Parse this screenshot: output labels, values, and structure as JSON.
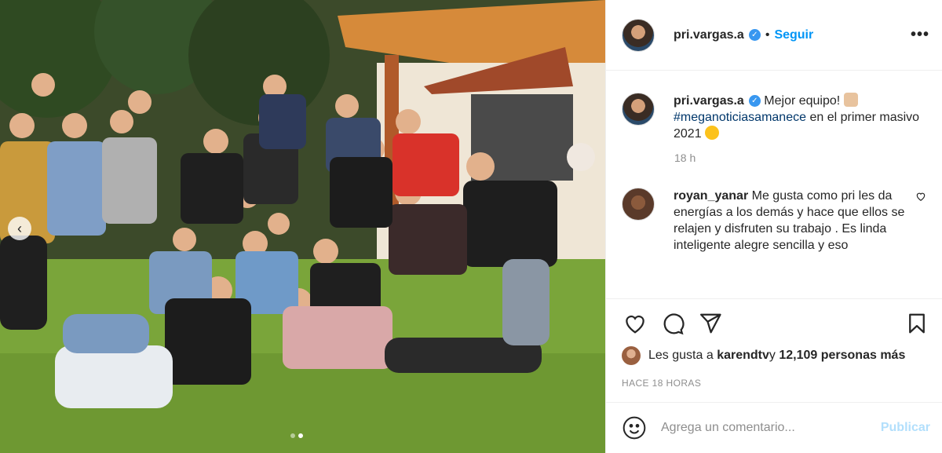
{
  "post": {
    "username": "pri.vargas.a",
    "separator": "•",
    "follow_label": "Seguir",
    "more_label": "•••",
    "photo_alt": "Group photo"
  },
  "caption": {
    "username": "pri.vargas.a",
    "text_before": "Mejor equipo! ",
    "hashtag": "#meganoticiasamanece",
    "text_after": " en el primer masivo 2021 ",
    "time": "18 h"
  },
  "comment": {
    "username": "royan_yanar",
    "text": " Me gusta como pri les da energías a los demás y hace que ellos se relajen y disfruten su trabajo . Es linda inteligente alegre sencilla y eso"
  },
  "likes": {
    "prefix": "Les gusta a ",
    "user": "karendtv",
    "middle": " y ",
    "count": "12,109 personas más"
  },
  "timestamp": "HACE 18 HORAS",
  "add_comment": {
    "placeholder": "Agrega un comentario...",
    "publish_label": "Publicar"
  },
  "icons": {
    "verified": "verified-badge-icon",
    "like": "heart-icon",
    "comment": "comment-bubble-icon",
    "share": "paper-plane-icon",
    "save": "bookmark-icon",
    "emoji": "smiley-face-icon",
    "prev": "chevron-left-icon"
  },
  "colors": {
    "link": "#0095f6",
    "publish_disabled": "#b2dffc",
    "muted": "#8e8e8e",
    "text": "#262626",
    "verified": "#3897f0"
  },
  "carousel": {
    "slides": 2,
    "active": 2
  }
}
